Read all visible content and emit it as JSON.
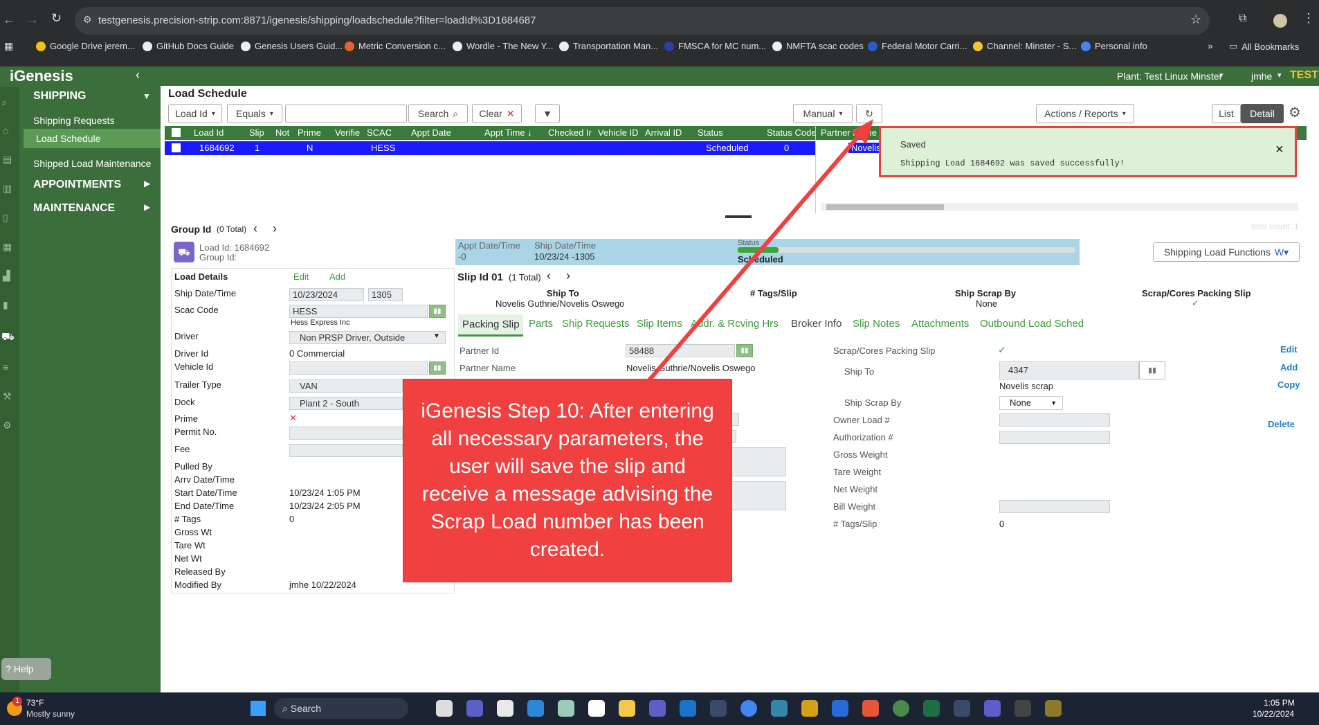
{
  "browser": {
    "url": "testgenesis.precision-strip.com:8871/igenesis/shipping/loadschedule?filter=loadId%3D1684687",
    "bookmarks": [
      "Google Drive jerem...",
      "GitHub Docs Guide",
      "Genesis Users Guid...",
      "Metric Conversion c...",
      "Wordle - The New Y...",
      "Transportation Man...",
      "FMSCA for MC num...",
      "NMFTA scac codes",
      "Federal Motor Carri...",
      "Channel: Minster - S...",
      "Personal info"
    ],
    "all_bookmarks": "All Bookmarks"
  },
  "app": {
    "logo": "iGenesis",
    "plant": "Plant: Test Linux Minster",
    "user": "jmhe",
    "env": "TEST"
  },
  "sidebar": {
    "shipping": "SHIPPING",
    "items": [
      "Shipping Requests",
      "Load Schedule",
      "Shipped Load Maintenance"
    ],
    "appointments": "APPOINTMENTS",
    "maintenance": "MAINTENANCE",
    "help": "Help"
  },
  "toolbar": {
    "page_title": "Load Schedule",
    "field_select": "Load Id",
    "op_select": "Equals",
    "search_value": "",
    "search_label": "Search",
    "clear_label": "Clear",
    "manual_label": "Manual",
    "actions_label": "Actions / Reports",
    "list_label": "List",
    "detail_label": "Detail"
  },
  "grid": {
    "columns": [
      "Load Id",
      "Slip",
      "Not",
      "Prime",
      "Verifie",
      "SCAC",
      "Appt Date",
      "Appt Time ↓",
      "Checked Ir",
      "Vehicle ID",
      "Arrival ID",
      "Status",
      "Status Code",
      "Partner Name"
    ],
    "row": {
      "load_id": "1684692",
      "slip": "1",
      "prime": "N",
      "scac": "HESS",
      "status": "Scheduled",
      "status_code": "0",
      "partner": "Novelis G"
    },
    "total_count": "total count: 1"
  },
  "toast": {
    "title": "Saved",
    "message": "Shipping Load 1684692 was saved successfully!",
    "close": "×"
  },
  "group": {
    "label": "Group Id",
    "total": "(0 Total)",
    "load_id": "Load Id: 1684692",
    "group_id": "Group Id:"
  },
  "banner": {
    "appt_label": "Appt Date/Time",
    "appt_val": "-0",
    "ship_label": "Ship Date/Time",
    "ship_val": "10/23/24 -1305",
    "status_label": "Status",
    "status_val": "Scheduled",
    "shipping_functions": "Shipping Load Functions"
  },
  "load_details": {
    "title": "Load Details",
    "edit": "Edit",
    "add": "Add",
    "ship_dt_label": "Ship Date/Time",
    "ship_date": "10/23/2024",
    "ship_time": "1305",
    "scac_label": "Scac Code",
    "scac": "HESS",
    "scac_name": "Hess Express Inc",
    "driver_label": "Driver",
    "driver": "Non PRSP Driver, Outside",
    "driver_id_label": "Driver Id",
    "driver_id": "0 Commercial",
    "vehicle_label": "Vehicle Id",
    "trailer_label": "Trailer Type",
    "trailer": "VAN",
    "dock_label": "Dock",
    "dock": "Plant 2 - South",
    "prime_label": "Prime",
    "prime_mark": "✕",
    "permit_label": "Permit No.",
    "fee_label": "Fee",
    "pulled_label": "Pulled By",
    "arrv_label": "Arrv Date/Time",
    "start_label": "Start Date/Time",
    "start": "10/23/24 1:05 PM",
    "end_label": "End Date/Time",
    "end": "10/23/24 2:05 PM",
    "tags_label": "# Tags",
    "tags": "0",
    "gross_label": "Gross Wt",
    "tare_label": "Tare Wt",
    "net_label": "Net Wt",
    "released_label": "Released By",
    "modified_label": "Modified By",
    "modified": "jmhe 10/22/2024"
  },
  "slip": {
    "title": "Slip Id 01",
    "total": "(1 Total)",
    "ship_to_h": "Ship To",
    "ship_to_v": "Novelis Guthrie/Novelis Oswego",
    "tags_h": "# Tags/Slip",
    "scrap_by_h": "Ship Scrap By",
    "scrap_by_v": "None",
    "packing_h": "Scrap/Cores Packing Slip",
    "tabs": [
      "Packing Slip",
      "Parts",
      "Ship Requests",
      "Slip Items",
      "Addr. & Rcving Hrs",
      "Broker Info",
      "Slip Notes",
      "Attachments",
      "Outbound Load Sched"
    ],
    "partner_id_label": "Partner Id",
    "partner_id": "58488",
    "partner_name_label": "Partner Name",
    "partner_name": "Novelis Guthrie/Novelis Oswego",
    "packing_label": "Scrap/Cores Packing Slip",
    "ship_to_label": "Ship To",
    "ship_to_id": "4347",
    "ship_to_name": "Novelis scrap",
    "scrap_by_label": "Ship Scrap By",
    "scrap_by": "None",
    "owner_label": "Owner Load #",
    "auth_label": "Authorization #",
    "gross_label": "Gross Weight",
    "tare_label": "Tare Weight",
    "net_label": "Net Weight",
    "bill_label": "Bill Weight",
    "tags_label": "# Tags/Slip",
    "tags": "0",
    "edit": "Edit",
    "add": "Add",
    "copy": "Copy",
    "delete": "Delete"
  },
  "callout": {
    "text": "iGenesis Step 10: After entering all necessary parameters, the user will save the slip and receive a message advising the Scrap Load number has been created."
  },
  "taskbar": {
    "temp": "73°F",
    "weather": "Mostly sunny",
    "search": "Search",
    "time": "1:05 PM",
    "date": "10/22/2024",
    "badge": "1"
  },
  "colors": {
    "sidebar": "#3b6e3b",
    "accent": "#3c9a3c",
    "row_select": "#1a1aff",
    "callout": "#f0403f",
    "toast": "#dff0d8"
  }
}
